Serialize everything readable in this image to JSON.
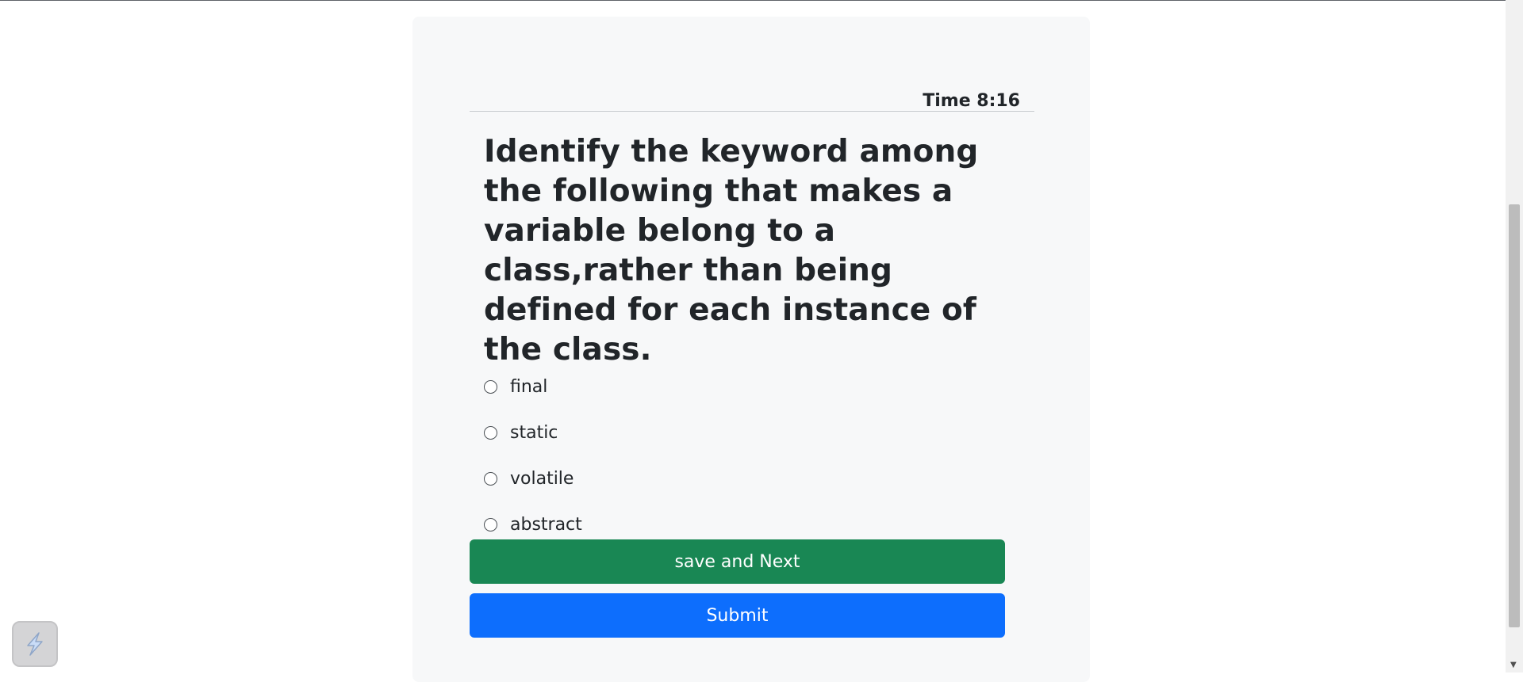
{
  "timer": {
    "text": "Time 8:16"
  },
  "question": {
    "text": "Identify the keyword among the following that makes a variable belong to a class,rather than being defined for each instance of the class."
  },
  "options": [
    {
      "label": "final",
      "selected": false
    },
    {
      "label": "static",
      "selected": false
    },
    {
      "label": "volatile",
      "selected": false
    },
    {
      "label": "abstract",
      "selected": false
    }
  ],
  "buttons": {
    "save_next_label": "save and Next",
    "submit_label": "Submit"
  },
  "colors": {
    "save_next": "#198754",
    "submit": "#0d6efd",
    "card_background": "#f7f8f9"
  },
  "icons": {
    "floating_badge": "lightning-bolt-icon"
  }
}
